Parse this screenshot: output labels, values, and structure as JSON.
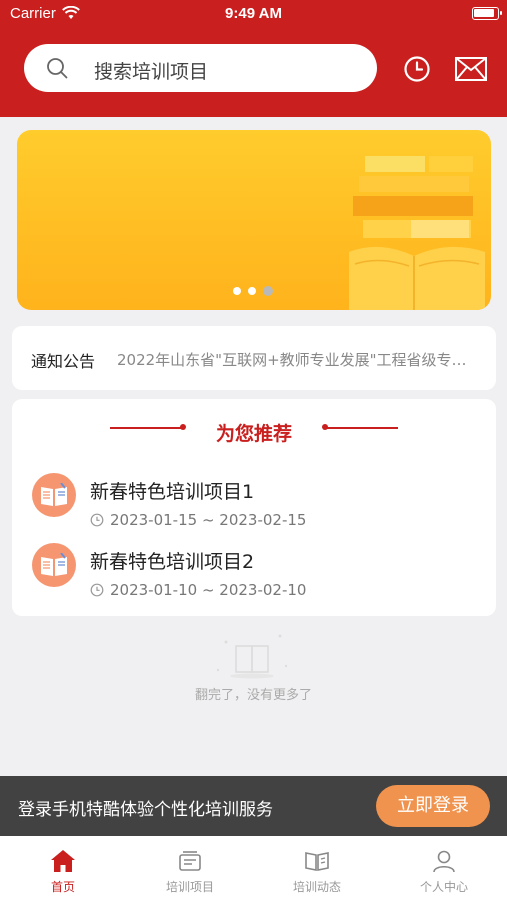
{
  "status_bar": {
    "carrier": "Carrier",
    "time": "9:49 AM"
  },
  "search": {
    "placeholder": "搜索培训项目"
  },
  "notice": {
    "label": "通知公告",
    "text": "2022年山东省\"互联网+教师专业发展\"工程省级专…"
  },
  "recommend": {
    "title": "为您推荐",
    "items": [
      {
        "title": "新春特色培训项目1",
        "date_range": "2023-01-15  ~  2023-02-15"
      },
      {
        "title": "新春特色培训项目2",
        "date_range": "2023-01-10  ~  2023-02-10"
      }
    ]
  },
  "empty": {
    "text": "翻完了，没有更多了"
  },
  "login_bar": {
    "text": "登录手机特酷体验个性化培训服务",
    "button": "立即登录"
  },
  "tabs": [
    {
      "label": "首页",
      "icon": "home-icon",
      "active": true
    },
    {
      "label": "培训项目",
      "icon": "projects-icon",
      "active": false
    },
    {
      "label": "培训动态",
      "icon": "book-news-icon",
      "active": false
    },
    {
      "label": "个人中心",
      "icon": "user-icon",
      "active": false
    }
  ],
  "carousel": {
    "count": 3,
    "active_index": 2
  },
  "colors": {
    "primary": "#c9201f",
    "accent": "#f0934e",
    "banner": "#ffbd22",
    "login_bar": "#424242"
  }
}
